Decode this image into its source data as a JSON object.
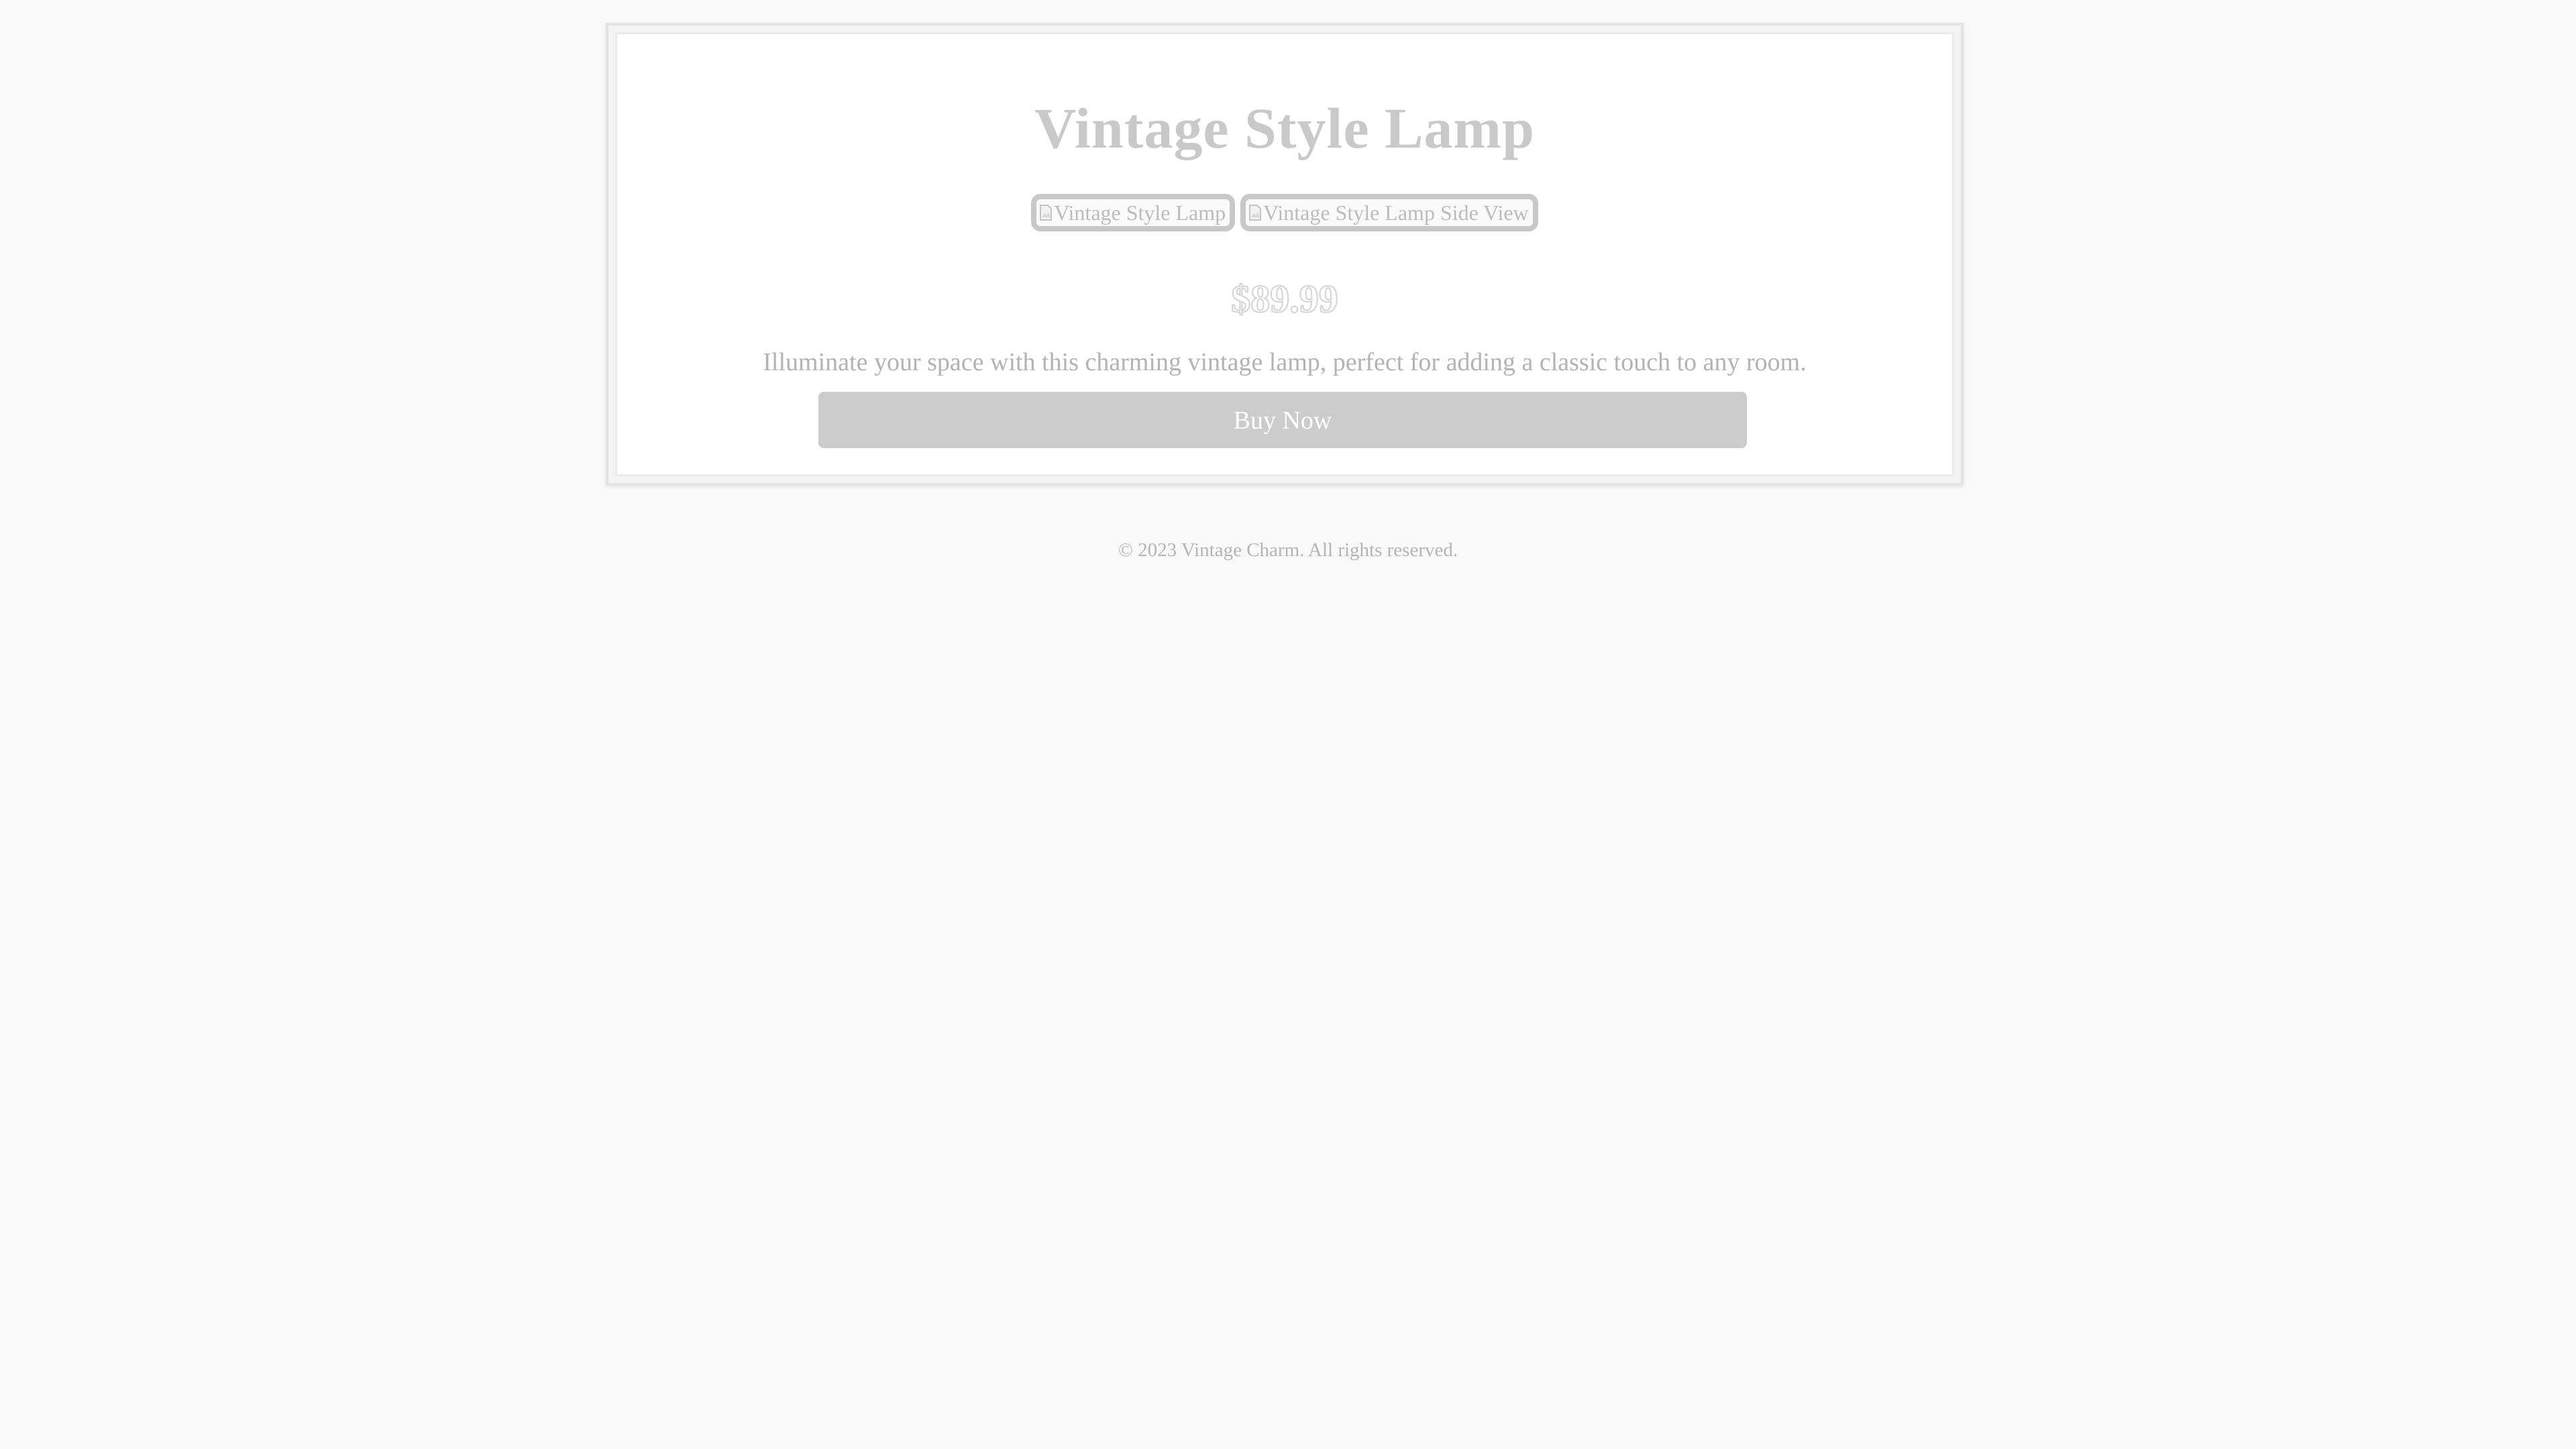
{
  "product": {
    "title": "Vintage Style Lamp",
    "images": [
      {
        "alt": "Vintage Style Lamp",
        "icon": "broken-image-icon"
      },
      {
        "alt": "Vintage Style Lamp Side View",
        "icon": "broken-image-icon"
      }
    ],
    "price": "$89.99",
    "description": "Illuminate your space with this charming vintage lamp, perfect for adding a classic touch to any room.",
    "buy_label": "Buy Now"
  },
  "footer": {
    "copyright": "© 2023 Vintage Charm. All rights reserved."
  },
  "colors": {
    "background": "#f9f9f9",
    "card": "#ffffff",
    "button": "#cccccc",
    "button_text": "#ffffff",
    "muted_text": "#b3b3b3"
  }
}
